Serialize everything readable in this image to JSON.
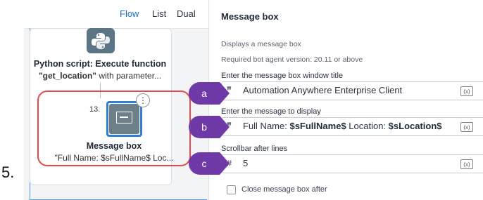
{
  "step_number": "5.",
  "view_tabs": [
    "Flow",
    "List",
    "Dual"
  ],
  "flow": {
    "python_action": {
      "title": "Python script: Execute function",
      "subtitle_bold": "\"get_location\"",
      "subtitle_rest": " with parameter..."
    },
    "message_action": {
      "line_number": "13.",
      "title": "Message box",
      "subtitle": "\"Full Name: $sFullName$ Loc..."
    },
    "more_icon": "⋮"
  },
  "panel": {
    "title": "Message box",
    "description": "Displays a message box",
    "requirement": "Required bot agent version: 20.11 or above",
    "fields": [
      {
        "label": "Enter the message box window title",
        "prefix": "❞",
        "value": "Automation Anywhere Enterprise Client",
        "callout": "a"
      },
      {
        "label": "Enter the message to display",
        "prefix": "❞",
        "value_parts": [
          "Full Name: ",
          "$sFullName$",
          " Location: ",
          "$sLocation$"
        ],
        "callout": "b"
      },
      {
        "label": "Scrollbar after lines",
        "prefix": "#",
        "value": "5",
        "callout": "c"
      }
    ],
    "var_button": "(x)",
    "checkbox_label": "Close message box after"
  },
  "colors": {
    "callout": "#6f3aa8",
    "highlight": "#e5484d",
    "selection": "#2f7fd6",
    "active_tab": "#1b6ed0"
  }
}
